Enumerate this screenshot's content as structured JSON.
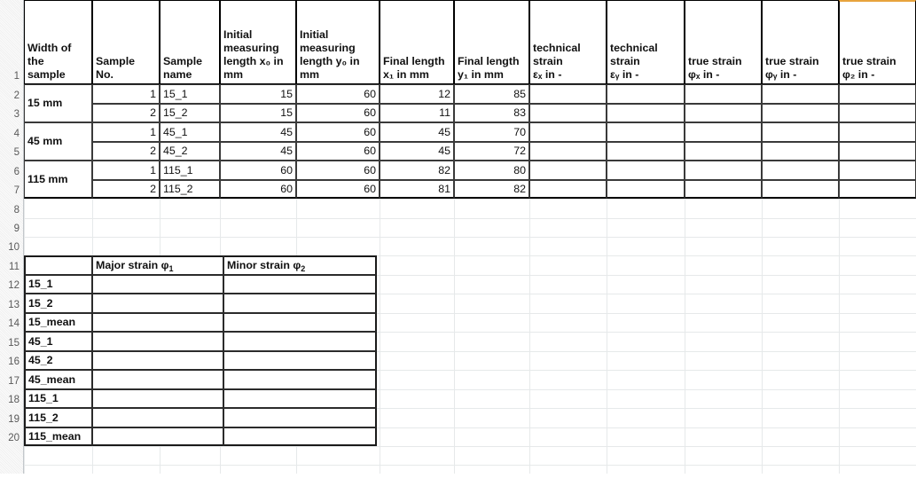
{
  "grid": {
    "row_numbers": [
      "1",
      "2",
      "3",
      "4",
      "5",
      "6",
      "7",
      "8",
      "9",
      "10",
      "11",
      "12",
      "13",
      "14",
      "15",
      "16",
      "17",
      "18",
      "19",
      "20"
    ],
    "accent_color": "#e8a33d"
  },
  "main_table": {
    "headers": [
      {
        "id": "width-of-the-sample",
        "lines": [
          "Width of",
          "the",
          "sample"
        ]
      },
      {
        "id": "sample-no",
        "lines": [
          "Sample",
          "No."
        ]
      },
      {
        "id": "sample-name",
        "lines": [
          "Sample",
          "name"
        ]
      },
      {
        "id": "initial-measuring-length-x0",
        "lines": [
          "Initial",
          "measuring",
          "length x₀ in",
          "mm"
        ]
      },
      {
        "id": "initial-measuring-length-y0",
        "lines": [
          "Initial",
          "measuring",
          "length y₀ in",
          "mm"
        ]
      },
      {
        "id": "final-length-x1",
        "lines": [
          "Final length",
          "x₁ in mm"
        ]
      },
      {
        "id": "final-length-y1",
        "lines": [
          "Final length",
          "y₁ in mm"
        ]
      },
      {
        "id": "technical-strain-ex",
        "lines": [
          "technical",
          "strain",
          "εₓ in -"
        ]
      },
      {
        "id": "technical-strain-ey",
        "lines": [
          "technical",
          "strain",
          "εᵧ in -"
        ]
      },
      {
        "id": "true-strain-phix",
        "lines": [
          "true strain",
          "φₓ in -"
        ]
      },
      {
        "id": "true-strain-phiy",
        "lines": [
          "true strain",
          "φᵧ in -"
        ]
      },
      {
        "id": "true-strain-phiz",
        "lines": [
          "true strain",
          "φ₂ in -"
        ]
      }
    ],
    "width_groups": [
      {
        "label": "15 mm",
        "rows": [
          "2",
          "3"
        ]
      },
      {
        "label": "45 mm",
        "rows": [
          "4",
          "5"
        ]
      },
      {
        "label": "115 mm",
        "rows": [
          "6",
          "7"
        ]
      }
    ],
    "rows": [
      {
        "row": "2",
        "sample_no": "1",
        "sample_name": "15_1",
        "x0": "15",
        "y0": "60",
        "x1": "12",
        "y1": "85",
        "eps_x": "",
        "eps_y": "",
        "phi_x": "",
        "phi_y": "",
        "phi_z": ""
      },
      {
        "row": "3",
        "sample_no": "2",
        "sample_name": "15_2",
        "x0": "15",
        "y0": "60",
        "x1": "11",
        "y1": "83",
        "eps_x": "",
        "eps_y": "",
        "phi_x": "",
        "phi_y": "",
        "phi_z": ""
      },
      {
        "row": "4",
        "sample_no": "1",
        "sample_name": "45_1",
        "x0": "45",
        "y0": "60",
        "x1": "45",
        "y1": "70",
        "eps_x": "",
        "eps_y": "",
        "phi_x": "",
        "phi_y": "",
        "phi_z": ""
      },
      {
        "row": "5",
        "sample_no": "2",
        "sample_name": "45_2",
        "x0": "45",
        "y0": "60",
        "x1": "45",
        "y1": "72",
        "eps_x": "",
        "eps_y": "",
        "phi_x": "",
        "phi_y": "",
        "phi_z": ""
      },
      {
        "row": "6",
        "sample_no": "1",
        "sample_name": "115_1",
        "x0": "60",
        "y0": "60",
        "x1": "82",
        "y1": "80",
        "eps_x": "",
        "eps_y": "",
        "phi_x": "",
        "phi_y": "",
        "phi_z": ""
      },
      {
        "row": "7",
        "sample_no": "2",
        "sample_name": "115_2",
        "x0": "60",
        "y0": "60",
        "x1": "81",
        "y1": "82",
        "eps_x": "",
        "eps_y": "",
        "phi_x": "",
        "phi_y": "",
        "phi_z": ""
      }
    ]
  },
  "strain_table": {
    "headers": {
      "corner": "",
      "major": {
        "text": "Major strain φ",
        "sub": "1"
      },
      "minor": {
        "text": "Minor strain φ",
        "sub": "2"
      }
    },
    "rows": [
      {
        "row": "12",
        "label": "15_1",
        "major": "",
        "minor": ""
      },
      {
        "row": "13",
        "label": "15_2",
        "major": "",
        "minor": ""
      },
      {
        "row": "14",
        "label": "15_mean",
        "major": "",
        "minor": ""
      },
      {
        "row": "15",
        "label": "45_1",
        "major": "",
        "minor": ""
      },
      {
        "row": "16",
        "label": "45_2",
        "major": "",
        "minor": ""
      },
      {
        "row": "17",
        "label": "45_mean",
        "major": "",
        "minor": ""
      },
      {
        "row": "18",
        "label": "115_1",
        "major": "",
        "minor": ""
      },
      {
        "row": "19",
        "label": "115_2",
        "major": "",
        "minor": ""
      },
      {
        "row": "20",
        "label": "115_mean",
        "major": "",
        "minor": ""
      }
    ]
  }
}
